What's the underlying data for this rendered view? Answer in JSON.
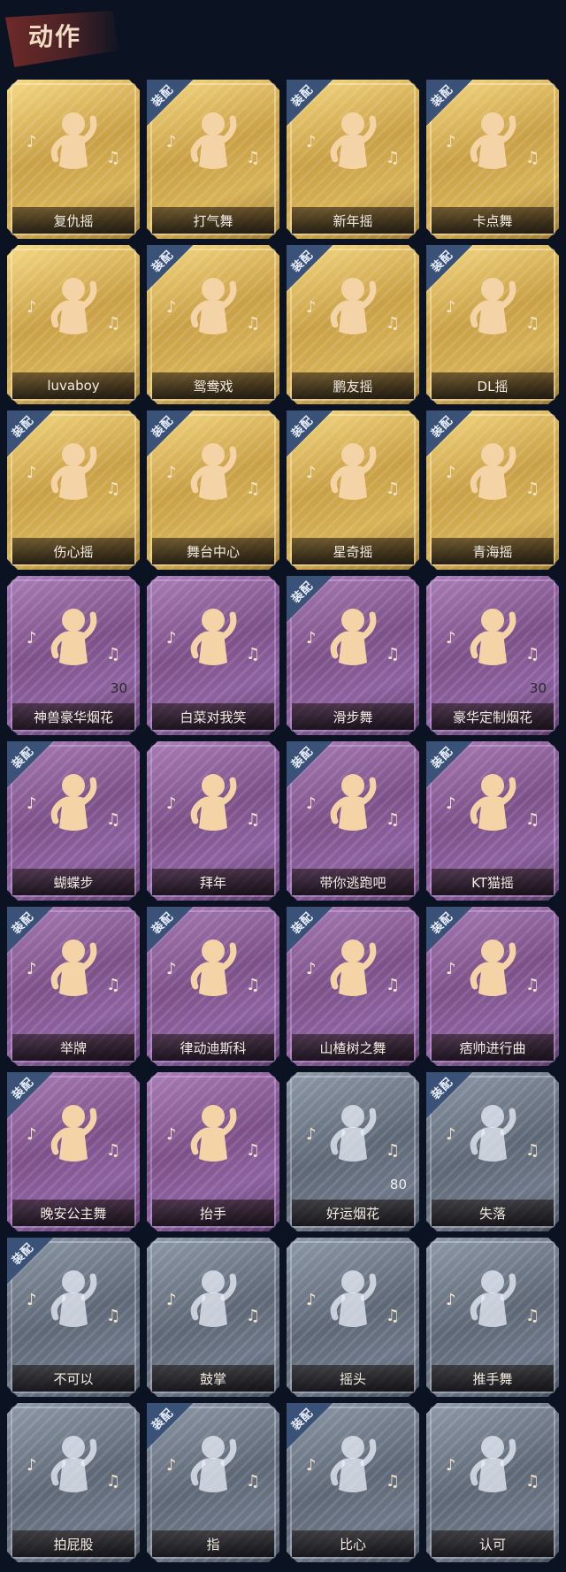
{
  "header": {
    "title": "动作"
  },
  "equipped_badge": "装配",
  "colors": {
    "gold": "#d7b257",
    "purple": "#8d62a0",
    "gray": "#6e7888",
    "badge": "#3a5178"
  },
  "emotes": [
    {
      "label": "复仇摇",
      "tier": "gold",
      "equipped": false,
      "count": "",
      "icon": "figure-arm-raised-icon"
    },
    {
      "label": "打气舞",
      "tier": "gold",
      "equipped": true,
      "count": "",
      "icon": "figure-cheer-icon"
    },
    {
      "label": "新年摇",
      "tier": "gold",
      "equipped": true,
      "count": "",
      "icon": "figure-sway-icon"
    },
    {
      "label": "卡点舞",
      "tier": "gold",
      "equipped": true,
      "count": "",
      "icon": "figure-point-up-icon"
    },
    {
      "label": "luvaboy",
      "tier": "gold",
      "equipped": false,
      "count": "",
      "icon": "figure-cross-arms-icon"
    },
    {
      "label": "鸳鸯戏",
      "tier": "gold",
      "equipped": true,
      "count": "",
      "icon": "figure-dance-icon"
    },
    {
      "label": "鹏友摇",
      "tier": "gold",
      "equipped": true,
      "count": "",
      "icon": "figure-wave-icon"
    },
    {
      "label": "DL摇",
      "tier": "gold",
      "equipped": true,
      "count": "",
      "icon": "figure-arms-up-icon"
    },
    {
      "label": "伤心摇",
      "tier": "gold",
      "equipped": true,
      "count": "",
      "icon": "figure-heart-hands-icon"
    },
    {
      "label": "舞台中心",
      "tier": "gold",
      "equipped": true,
      "count": "",
      "icon": "figure-pose-icon"
    },
    {
      "label": "星奇摇",
      "tier": "gold",
      "equipped": true,
      "count": "",
      "icon": "figure-star-icon"
    },
    {
      "label": "青海摇",
      "tier": "gold",
      "equipped": true,
      "count": "",
      "icon": "figure-shake-icon"
    },
    {
      "label": "神兽豪华烟花",
      "tier": "purple",
      "equipped": false,
      "count": "30",
      "icon": "fireworks-icon"
    },
    {
      "label": "白菜对我笑",
      "tier": "purple",
      "equipped": false,
      "count": "",
      "icon": "figure-smile-icon"
    },
    {
      "label": "滑步舞",
      "tier": "purple",
      "equipped": true,
      "count": "",
      "icon": "figure-slide-icon"
    },
    {
      "label": "豪华定制烟花",
      "tier": "purple",
      "equipped": false,
      "count": "30",
      "icon": "fireworks-box-icon"
    },
    {
      "label": "蝴蝶步",
      "tier": "purple",
      "equipped": true,
      "count": "",
      "icon": "figure-point-side-icon"
    },
    {
      "label": "拜年",
      "tier": "purple",
      "equipped": false,
      "count": "",
      "icon": "figure-bow-icon"
    },
    {
      "label": "带你逃跑吧",
      "tier": "purple",
      "equipped": true,
      "count": "",
      "icon": "figure-run-icon"
    },
    {
      "label": "KT猫摇",
      "tier": "purple",
      "equipped": true,
      "count": "",
      "icon": "figure-cat-icon"
    },
    {
      "label": "举牌",
      "tier": "purple",
      "equipped": true,
      "count": "",
      "icon": "figure-sign-icon"
    },
    {
      "label": "律动迪斯科",
      "tier": "purple",
      "equipped": true,
      "count": "",
      "icon": "figure-disco-icon"
    },
    {
      "label": "山楂树之舞",
      "tier": "purple",
      "equipped": true,
      "count": "",
      "icon": "figure-twirl-icon"
    },
    {
      "label": "痞帅进行曲",
      "tier": "purple",
      "equipped": true,
      "count": "",
      "icon": "figure-march-icon"
    },
    {
      "label": "晚安公主舞",
      "tier": "purple",
      "equipped": true,
      "count": "",
      "icon": "figure-princess-icon"
    },
    {
      "label": "抬手",
      "tier": "purple",
      "equipped": false,
      "count": "",
      "icon": "figure-raise-hand-icon"
    },
    {
      "label": "好运烟花",
      "tier": "gray",
      "equipped": false,
      "count": "80",
      "icon": "firework-can-icon"
    },
    {
      "label": "失落",
      "tier": "gray",
      "equipped": true,
      "count": "",
      "icon": "figure-crawl-icon"
    },
    {
      "label": "不可以",
      "tier": "gray",
      "equipped": true,
      "count": "",
      "icon": "finger-wag-icon"
    },
    {
      "label": "鼓掌",
      "tier": "gray",
      "equipped": false,
      "count": "",
      "icon": "clap-icon"
    },
    {
      "label": "摇头",
      "tier": "gray",
      "equipped": false,
      "count": "",
      "icon": "figure-head-shake-icon"
    },
    {
      "label": "推手舞",
      "tier": "gray",
      "equipped": false,
      "count": "",
      "icon": "figure-push-icon"
    },
    {
      "label": "拍屁股",
      "tier": "gray",
      "equipped": false,
      "count": "",
      "icon": "figure-slap-icon"
    },
    {
      "label": "指",
      "tier": "gray",
      "equipped": true,
      "count": "",
      "icon": "pointing-hand-icon"
    },
    {
      "label": "比心",
      "tier": "gray",
      "equipped": true,
      "count": "",
      "icon": "finger-heart-icon"
    },
    {
      "label": "认可",
      "tier": "gray",
      "equipped": false,
      "count": "",
      "icon": "thumbs-up-icon"
    }
  ]
}
